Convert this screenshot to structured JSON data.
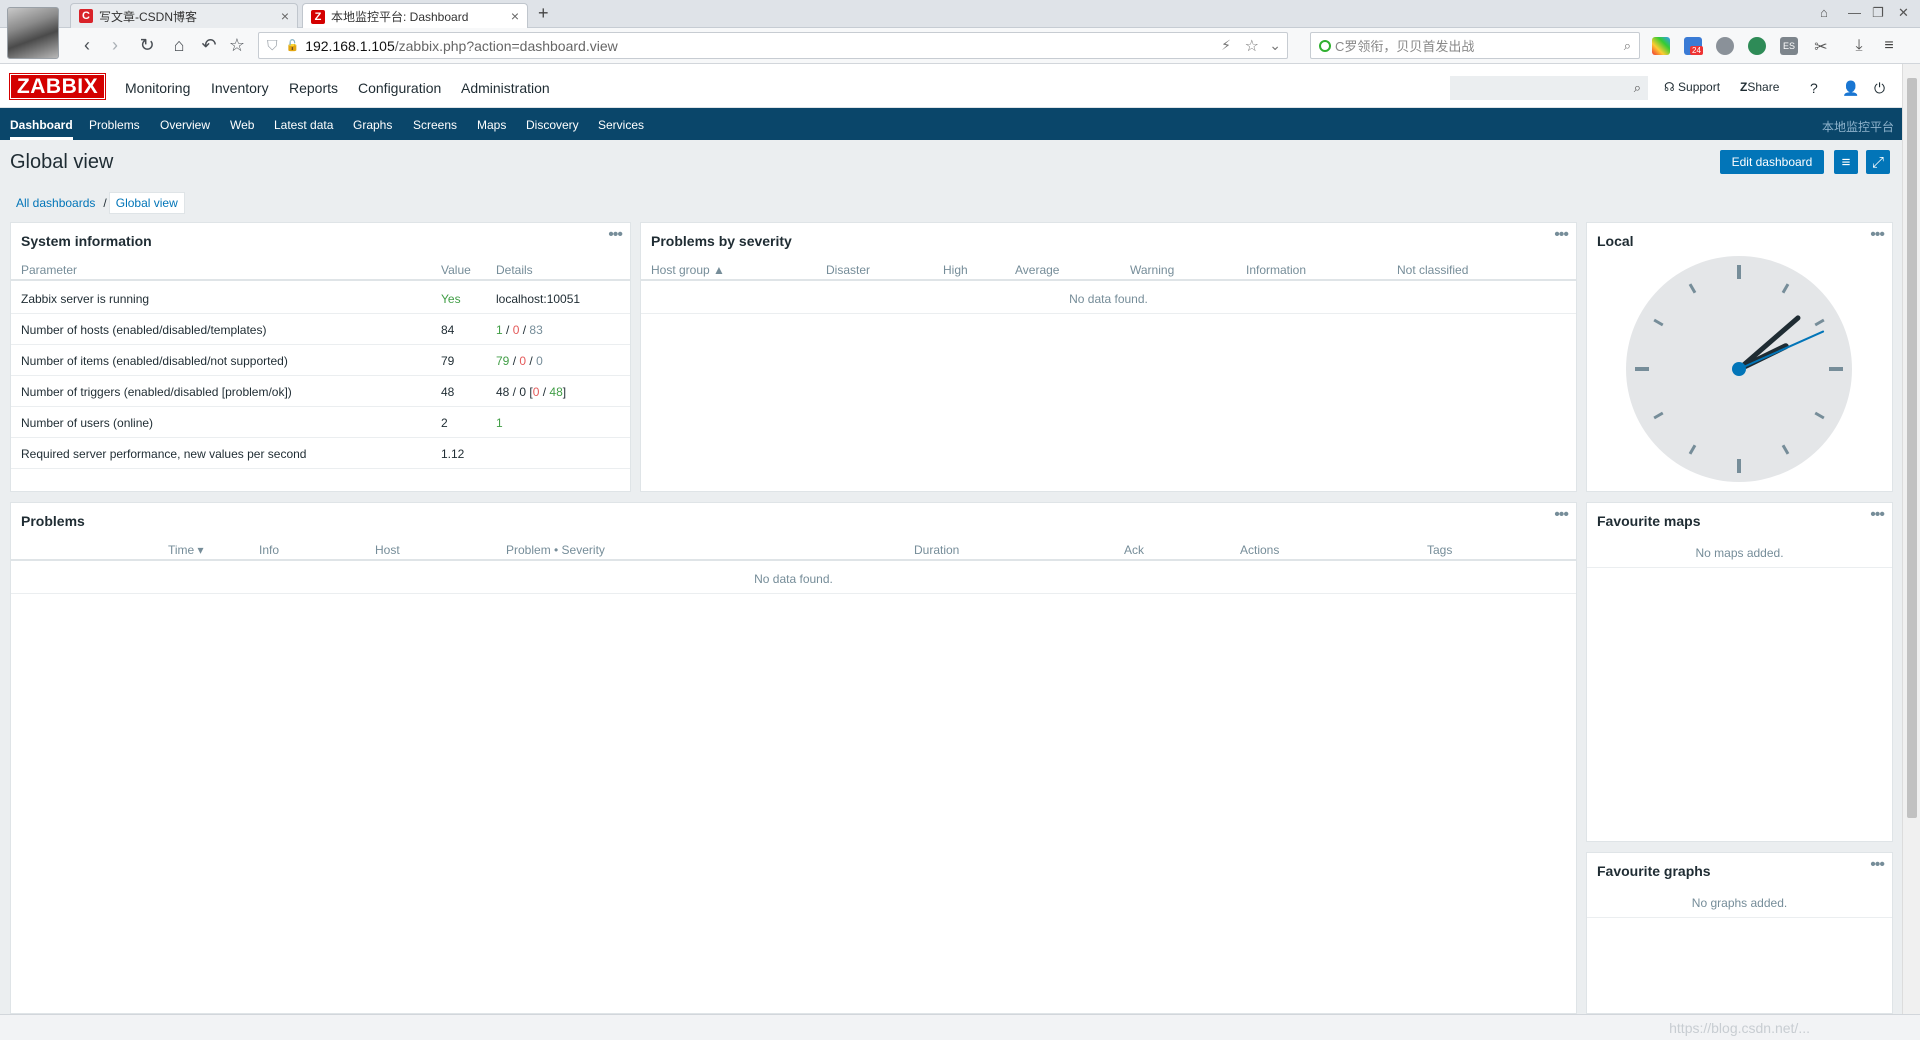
{
  "browser": {
    "tabs": [
      {
        "favicon": "C",
        "favicon_color": "#d9232a",
        "label": "写文章-CSDN博客"
      },
      {
        "favicon": "Z",
        "favicon_color": "#d40000",
        "label": "本地监控平台: Dashboard"
      }
    ],
    "url_host": "192.168.1.105",
    "url_path": "/zabbix.php?action=dashboard.view",
    "search_placeholder": "C罗领衔，贝贝首发出战",
    "ext_badge": "24"
  },
  "zabbix": {
    "logo": "ZABBIX",
    "menu": [
      "Monitoring",
      "Inventory",
      "Reports",
      "Configuration",
      "Administration"
    ],
    "support": "Support",
    "share": "Share",
    "help": "?",
    "submenu": [
      "Dashboard",
      "Problems",
      "Overview",
      "Web",
      "Latest data",
      "Graphs",
      "Screens",
      "Maps",
      "Discovery",
      "Services"
    ],
    "server_name": "本地监控平台"
  },
  "page": {
    "title": "Global view",
    "edit_dashboard": "Edit dashboard",
    "breadcrumb": [
      "All dashboards",
      "Global view"
    ]
  },
  "system_info": {
    "title": "System information",
    "headers": [
      "Parameter",
      "Value",
      "Details"
    ],
    "rows": [
      {
        "param": "Zabbix server is running",
        "value": "Yes",
        "details": "localhost:10051"
      },
      {
        "param": "Number of hosts (enabled/disabled/templates)",
        "value": "84",
        "d1": "1",
        "d2": "0",
        "d3": "83"
      },
      {
        "param": "Number of items (enabled/disabled/not supported)",
        "value": "79",
        "d1": "79",
        "d2": "0",
        "d3": "0"
      },
      {
        "param": "Number of triggers (enabled/disabled [problem/ok])",
        "value": "48",
        "d_prefix": "48 / 0 [",
        "d1": "0",
        "d2": "48",
        "d_suffix": "]"
      },
      {
        "param": "Number of users (online)",
        "value": "2",
        "d1": "1"
      },
      {
        "param": "Required server performance, new values per second",
        "value": "1.12"
      }
    ]
  },
  "problems_by_severity": {
    "title": "Problems by severity",
    "headers": [
      "Host group ▲",
      "Disaster",
      "High",
      "Average",
      "Warning",
      "Information",
      "Not classified"
    ],
    "empty": "No data found."
  },
  "local_clock": {
    "title": "Local",
    "hour": 2,
    "minute": 8,
    "second": 11
  },
  "problems": {
    "title": "Problems",
    "headers": [
      "Time ▾",
      "Info",
      "Host",
      "Problem • Severity",
      "Duration",
      "Ack",
      "Actions",
      "Tags"
    ],
    "empty": "No data found."
  },
  "favourite_maps": {
    "title": "Favourite maps",
    "empty": "No maps added."
  },
  "favourite_graphs": {
    "title": "Favourite graphs",
    "empty": "No graphs added."
  },
  "colors": {
    "brand": "#d40000",
    "nav": "#0a466a",
    "primary": "#0275b8",
    "ok": "#429e47",
    "problem": "#e45959"
  },
  "statusbar": {
    "watermark": "https://blog.csdn.net/..."
  }
}
